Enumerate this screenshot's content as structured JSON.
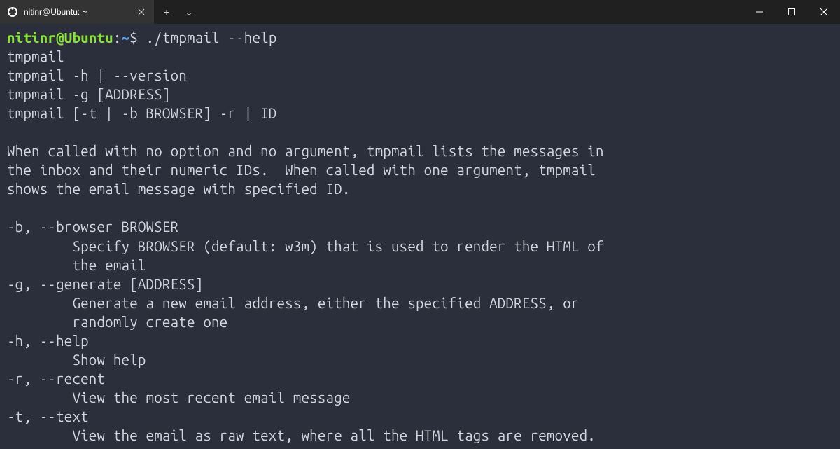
{
  "titlebar": {
    "tab_title": "nitinr@Ubuntu: ~",
    "new_tab_icon": "+",
    "dropdown_icon": "⌄"
  },
  "prompt": {
    "user": "nitinr",
    "at": "@",
    "host": "Ubuntu",
    "colon": ":",
    "path": "~",
    "dollar": "$",
    "command": " ./tmpmail --help"
  },
  "output": {
    "l1": "tmpmail",
    "l2": "tmpmail -h | --version",
    "l3": "tmpmail -g [ADDRESS]",
    "l4": "tmpmail [-t | -b BROWSER] -r | ID",
    "l5": "",
    "l6": "When called with no option and no argument, tmpmail lists the messages in",
    "l7": "the inbox and their numeric IDs.  When called with one argument, tmpmail",
    "l8": "shows the email message with specified ID.",
    "l9": "",
    "l10": "-b, --browser BROWSER",
    "l11": "        Specify BROWSER (default: w3m) that is used to render the HTML of",
    "l12": "        the email",
    "l13": "-g, --generate [ADDRESS]",
    "l14": "        Generate a new email address, either the specified ADDRESS, or",
    "l15": "        randomly create one",
    "l16": "-h, --help",
    "l17": "        Show help",
    "l18": "-r, --recent",
    "l19": "        View the most recent email message",
    "l20": "-t, --text",
    "l21": "        View the email as raw text, where all the HTML tags are removed."
  }
}
